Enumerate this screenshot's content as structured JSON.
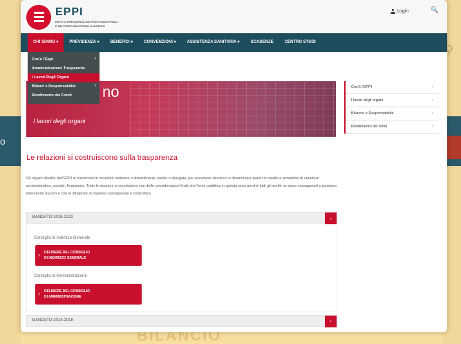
{
  "background": {
    "band_text": "o",
    "footer_text": "BILANCIO"
  },
  "header": {
    "logo_name": "EPPI",
    "logo_sub1": "ENTE DI PREVIDENZA DEI PERITI INDUSTRIALI",
    "logo_sub2": "E DEI PERITI INDUSTRIALI LAUREATI",
    "login_label": "Login",
    "search_glyph": "🔍"
  },
  "nav": {
    "items": [
      {
        "label": "CHI SIAMO ▾"
      },
      {
        "label": "PREVIDENZA ▾"
      },
      {
        "label": "BENEFICI ▾"
      },
      {
        "label": "CONVENZIONI ▾"
      },
      {
        "label": "ASSISTENZA SANITARIA ▾"
      },
      {
        "label": "SCADENZE"
      },
      {
        "label": "CENTRO STUDI"
      }
    ]
  },
  "dropdown": {
    "items": [
      {
        "label": "Cos'è l'Eppi",
        "caret": "›"
      },
      {
        "label": "Amministrazione Trasparente",
        "caret": ""
      },
      {
        "label": "I Lavori Degli Organi",
        "caret": ""
      },
      {
        "label": "Bilanci e Responsabilità",
        "caret": "›"
      },
      {
        "label": "Rendimento dei Fondi",
        "caret": ""
      }
    ]
  },
  "hero": {
    "title": "no",
    "subtitle": "I lavori degli organi"
  },
  "sidebar": {
    "items": [
      {
        "label": "Cos'è l'EPPI",
        "caret": "›"
      },
      {
        "label": "I lavori degli organi",
        "caret": "›"
      },
      {
        "label": "Bilancio e Responsabilità",
        "caret": "›"
      },
      {
        "label": "Rendimento dei fondi",
        "caret": "›"
      }
    ]
  },
  "content": {
    "heading": "Le relazioni si costruiscono sulla trasparenza",
    "paragraph": "Gli organi direttivi dell'EPPI si riuniscono in modalità ordinaria o straordinaria, riunita o allargata, per assumere decisioni e determinare pareri in merito a tematiche di carattere amministrativo, sociale, finanziario. Tutte le sessioni si concludono con delle considerazioni finali che l'ente pubblica in questa area perché tutti gli iscritti ne siano consapevoli e possano intervenire tra loro e con le dirigenze in maniera consapevole e costruttiva."
  },
  "accordion": {
    "first_title": "MANDATO 2018-2022",
    "first_toggle": "⌄",
    "group1_label": "Consiglio di Indirizzo Generale",
    "button1_line1": "DELIBERE DEL CONSIGLIO",
    "button1_line2": "DI INDIRIZZO GENERALE",
    "group2_label": "Consiglio di Amministrazione",
    "button2_line1": "DELIBERE DEL CONSIGLIO",
    "button2_line2": "DI AMMINISTRAZIONE",
    "button_arrow": "›",
    "second_title": "MANDATO 2014-2018",
    "second_toggle": "›"
  }
}
